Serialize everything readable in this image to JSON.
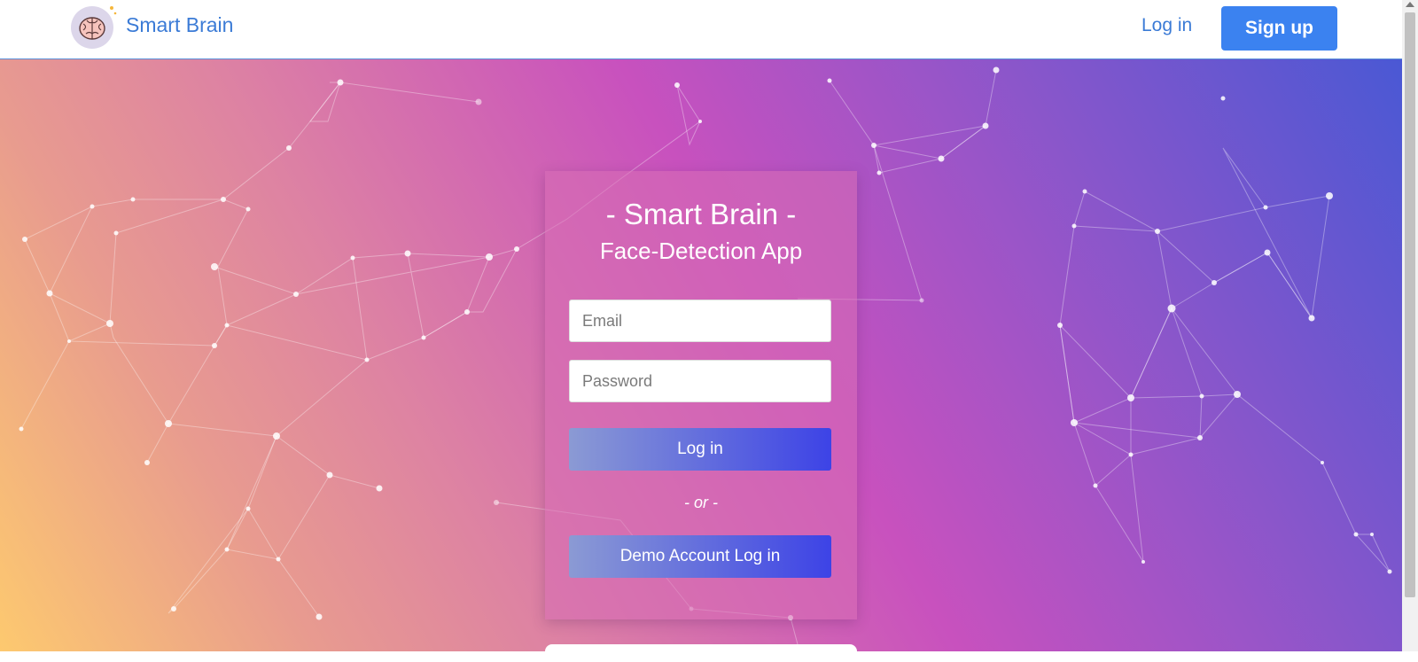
{
  "nav": {
    "brand": "Smart Brain",
    "login_label": "Log in",
    "signup_label": "Sign up",
    "logo_icon": "brain-icon",
    "accent": "#3b82f0"
  },
  "card": {
    "title": "- Smart Brain -",
    "subtitle": "Face-Detection App",
    "email_placeholder": "Email",
    "email_value": "",
    "password_placeholder": "Password",
    "password_value": "",
    "login_button": "Log in",
    "separator": "- or -",
    "demo_button": "Demo Account Log in"
  },
  "colors": {
    "gradient": [
      "#fdc96f",
      "#dd82a3",
      "#c851be",
      "#4a58d4"
    ],
    "button_gradient": [
      "#8b9ad4",
      "#3d43e6"
    ]
  }
}
